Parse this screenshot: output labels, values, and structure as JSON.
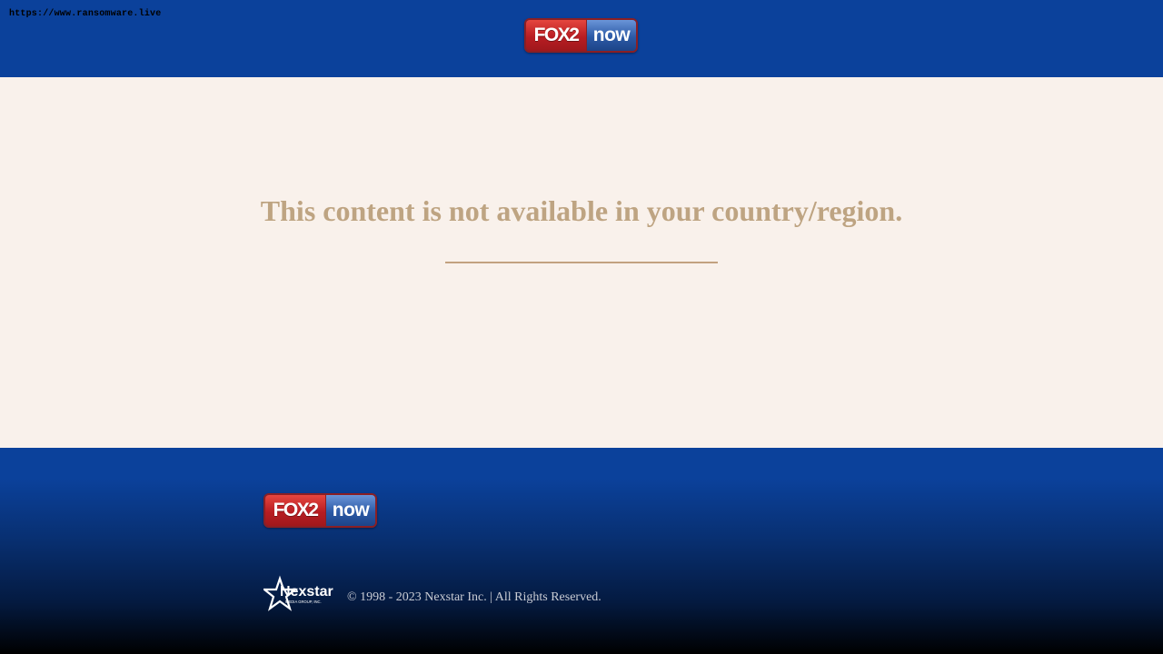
{
  "watermark": {
    "url": "https://www.ransomware.live"
  },
  "header": {
    "logo": {
      "part1": "FOX2",
      "part2": "now"
    }
  },
  "main": {
    "message": "This content is not available in your country/region."
  },
  "footer": {
    "logo": {
      "part1": "FOX2",
      "part2": "now"
    },
    "nexstar": {
      "name": "Nexstar",
      "subtitle": "MEDIA GROUP, INC."
    },
    "copyright": "© 1998 - 2023 Nexstar Inc. | All Rights Reserved."
  },
  "colors": {
    "header_blue": "#0b419b",
    "content_bg": "#f9f1eb",
    "message_tan": "#bea482",
    "fox_red": "#b81d22",
    "now_blue": "#2c5aa6"
  }
}
